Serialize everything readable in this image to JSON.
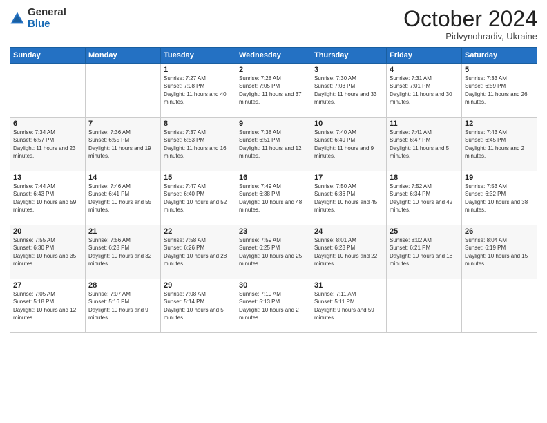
{
  "logo": {
    "general": "General",
    "blue": "Blue"
  },
  "title": "October 2024",
  "location": "Pidvynohradiv, Ukraine",
  "days_of_week": [
    "Sunday",
    "Monday",
    "Tuesday",
    "Wednesday",
    "Thursday",
    "Friday",
    "Saturday"
  ],
  "weeks": [
    [
      {
        "num": "",
        "info": ""
      },
      {
        "num": "",
        "info": ""
      },
      {
        "num": "1",
        "info": "Sunrise: 7:27 AM\nSunset: 7:08 PM\nDaylight: 11 hours and 40 minutes."
      },
      {
        "num": "2",
        "info": "Sunrise: 7:28 AM\nSunset: 7:05 PM\nDaylight: 11 hours and 37 minutes."
      },
      {
        "num": "3",
        "info": "Sunrise: 7:30 AM\nSunset: 7:03 PM\nDaylight: 11 hours and 33 minutes."
      },
      {
        "num": "4",
        "info": "Sunrise: 7:31 AM\nSunset: 7:01 PM\nDaylight: 11 hours and 30 minutes."
      },
      {
        "num": "5",
        "info": "Sunrise: 7:33 AM\nSunset: 6:59 PM\nDaylight: 11 hours and 26 minutes."
      }
    ],
    [
      {
        "num": "6",
        "info": "Sunrise: 7:34 AM\nSunset: 6:57 PM\nDaylight: 11 hours and 23 minutes."
      },
      {
        "num": "7",
        "info": "Sunrise: 7:36 AM\nSunset: 6:55 PM\nDaylight: 11 hours and 19 minutes."
      },
      {
        "num": "8",
        "info": "Sunrise: 7:37 AM\nSunset: 6:53 PM\nDaylight: 11 hours and 16 minutes."
      },
      {
        "num": "9",
        "info": "Sunrise: 7:38 AM\nSunset: 6:51 PM\nDaylight: 11 hours and 12 minutes."
      },
      {
        "num": "10",
        "info": "Sunrise: 7:40 AM\nSunset: 6:49 PM\nDaylight: 11 hours and 9 minutes."
      },
      {
        "num": "11",
        "info": "Sunrise: 7:41 AM\nSunset: 6:47 PM\nDaylight: 11 hours and 5 minutes."
      },
      {
        "num": "12",
        "info": "Sunrise: 7:43 AM\nSunset: 6:45 PM\nDaylight: 11 hours and 2 minutes."
      }
    ],
    [
      {
        "num": "13",
        "info": "Sunrise: 7:44 AM\nSunset: 6:43 PM\nDaylight: 10 hours and 59 minutes."
      },
      {
        "num": "14",
        "info": "Sunrise: 7:46 AM\nSunset: 6:41 PM\nDaylight: 10 hours and 55 minutes."
      },
      {
        "num": "15",
        "info": "Sunrise: 7:47 AM\nSunset: 6:40 PM\nDaylight: 10 hours and 52 minutes."
      },
      {
        "num": "16",
        "info": "Sunrise: 7:49 AM\nSunset: 6:38 PM\nDaylight: 10 hours and 48 minutes."
      },
      {
        "num": "17",
        "info": "Sunrise: 7:50 AM\nSunset: 6:36 PM\nDaylight: 10 hours and 45 minutes."
      },
      {
        "num": "18",
        "info": "Sunrise: 7:52 AM\nSunset: 6:34 PM\nDaylight: 10 hours and 42 minutes."
      },
      {
        "num": "19",
        "info": "Sunrise: 7:53 AM\nSunset: 6:32 PM\nDaylight: 10 hours and 38 minutes."
      }
    ],
    [
      {
        "num": "20",
        "info": "Sunrise: 7:55 AM\nSunset: 6:30 PM\nDaylight: 10 hours and 35 minutes."
      },
      {
        "num": "21",
        "info": "Sunrise: 7:56 AM\nSunset: 6:28 PM\nDaylight: 10 hours and 32 minutes."
      },
      {
        "num": "22",
        "info": "Sunrise: 7:58 AM\nSunset: 6:26 PM\nDaylight: 10 hours and 28 minutes."
      },
      {
        "num": "23",
        "info": "Sunrise: 7:59 AM\nSunset: 6:25 PM\nDaylight: 10 hours and 25 minutes."
      },
      {
        "num": "24",
        "info": "Sunrise: 8:01 AM\nSunset: 6:23 PM\nDaylight: 10 hours and 22 minutes."
      },
      {
        "num": "25",
        "info": "Sunrise: 8:02 AM\nSunset: 6:21 PM\nDaylight: 10 hours and 18 minutes."
      },
      {
        "num": "26",
        "info": "Sunrise: 8:04 AM\nSunset: 6:19 PM\nDaylight: 10 hours and 15 minutes."
      }
    ],
    [
      {
        "num": "27",
        "info": "Sunrise: 7:05 AM\nSunset: 5:18 PM\nDaylight: 10 hours and 12 minutes."
      },
      {
        "num": "28",
        "info": "Sunrise: 7:07 AM\nSunset: 5:16 PM\nDaylight: 10 hours and 9 minutes."
      },
      {
        "num": "29",
        "info": "Sunrise: 7:08 AM\nSunset: 5:14 PM\nDaylight: 10 hours and 5 minutes."
      },
      {
        "num": "30",
        "info": "Sunrise: 7:10 AM\nSunset: 5:13 PM\nDaylight: 10 hours and 2 minutes."
      },
      {
        "num": "31",
        "info": "Sunrise: 7:11 AM\nSunset: 5:11 PM\nDaylight: 9 hours and 59 minutes."
      },
      {
        "num": "",
        "info": ""
      },
      {
        "num": "",
        "info": ""
      }
    ]
  ]
}
